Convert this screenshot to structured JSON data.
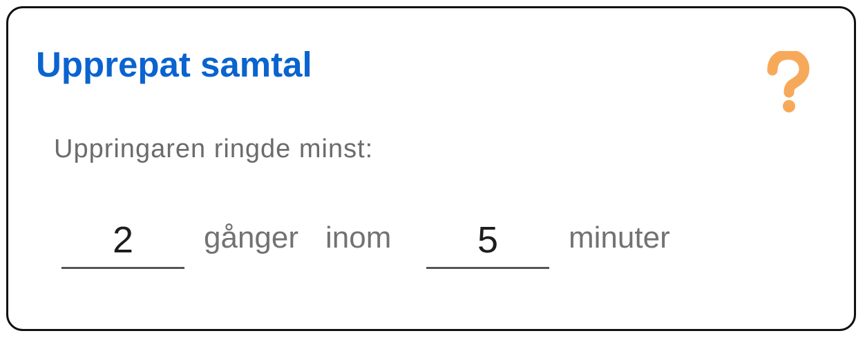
{
  "card": {
    "title": "Upprepat samtal",
    "help_icon": "question-mark-icon",
    "subtitle": "Uppringaren ringde minst:",
    "count_field": {
      "value": "2"
    },
    "times_label": "gånger",
    "within_label": "inom",
    "minutes_field": {
      "value": "5"
    },
    "minutes_label": "minuter"
  },
  "colors": {
    "title": "#0a63d0",
    "help_icon": "#f7a95a",
    "secondary_text": "#6b6b6b",
    "border": "#111111"
  }
}
